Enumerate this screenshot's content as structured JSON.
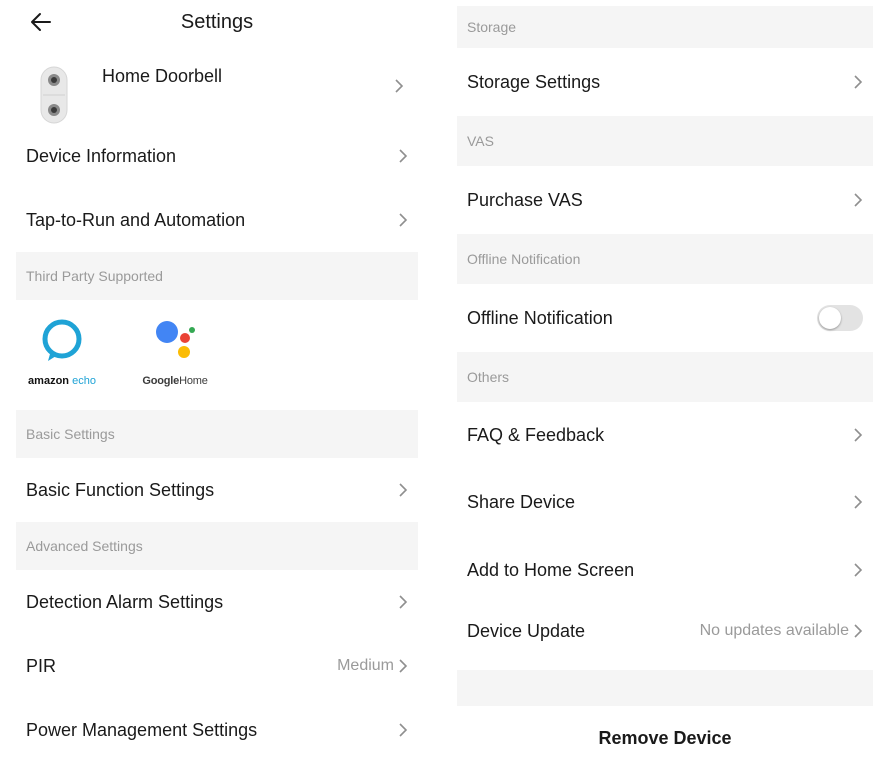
{
  "header": {
    "title": "Settings"
  },
  "device": {
    "name": "Home Doorbell"
  },
  "left_rows": {
    "device_information": "Device Information",
    "tap_to_run": "Tap-to-Run and Automation",
    "basic_function": "Basic Function Settings",
    "detection_alarm": "Detection Alarm Settings",
    "pir": "PIR",
    "pir_value": "Medium",
    "power_management": "Power Management Settings"
  },
  "sections": {
    "third_party": "Third Party Supported",
    "basic": "Basic Settings",
    "advanced": "Advanced Settings",
    "storage": "Storage",
    "vas": "VAS",
    "offline": "Offline Notification",
    "others": "Others"
  },
  "third_party": {
    "amazon_brand": "amazon",
    "amazon_product": "echo",
    "google_brand": "Google",
    "google_product": "Home"
  },
  "right_rows": {
    "storage_settings": "Storage Settings",
    "purchase_vas": "Purchase VAS",
    "offline_notification": "Offline Notification",
    "offline_notification_on": false,
    "faq": "FAQ & Feedback",
    "share_device": "Share Device",
    "add_home_screen": "Add to Home Screen",
    "device_update": "Device Update",
    "device_update_value": "No updates available"
  },
  "footer": {
    "remove_device": "Remove Device"
  },
  "colors": {
    "section_bg": "#f5f5f5",
    "section_text": "#9a9a9a",
    "alexa_blue": "#1fa3d6",
    "google_blue": "#4285f4",
    "google_red": "#ea4335",
    "google_yellow": "#fbbc05",
    "google_green": "#34a853"
  }
}
